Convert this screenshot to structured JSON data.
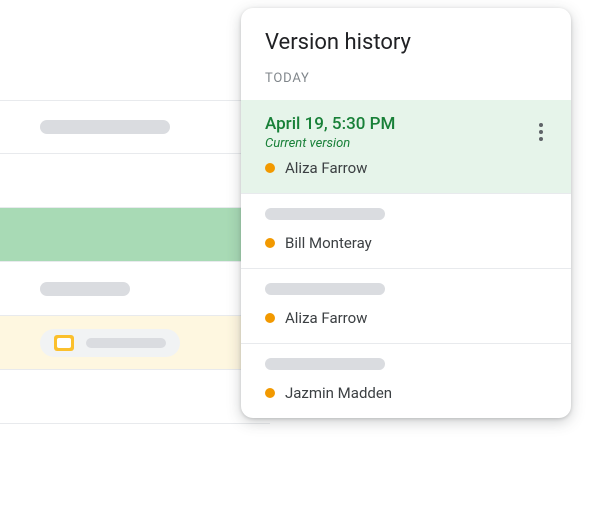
{
  "panel": {
    "title": "Version history",
    "section_label": "TODAY"
  },
  "versions": [
    {
      "date": "April 19, 5:30 PM",
      "subtitle": "Current version",
      "editor": "Aliza Farrow",
      "active": true
    },
    {
      "editor": "Bill Monteray"
    },
    {
      "editor": "Aliza Farrow"
    },
    {
      "editor": "Jazmin Madden"
    }
  ],
  "colors": {
    "active_bg": "#e6f4ea",
    "active_text": "#188038",
    "dot": "#f29900"
  }
}
